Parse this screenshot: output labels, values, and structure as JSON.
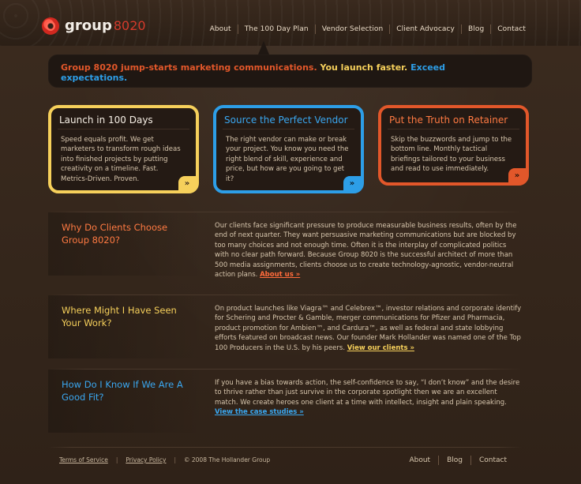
{
  "brand": {
    "name": "group",
    "number": "8020"
  },
  "nav": {
    "items": [
      {
        "label": "About"
      },
      {
        "label": "The 100 Day Plan"
      },
      {
        "label": "Vendor Selection"
      },
      {
        "label": "Client Advocacy"
      },
      {
        "label": "Blog"
      },
      {
        "label": "Contact"
      }
    ]
  },
  "hero": {
    "part1": "Group 8020 jump-starts marketing communications.",
    "part2": "You launch faster.",
    "part3": "Exceed expectations."
  },
  "cards": [
    {
      "title": "Launch in 100 Days",
      "body": "Speed equals profit. We get marketers to transform rough ideas into finished projects by putting creativity on a timeline. Fast. Metrics-Driven. Proven.",
      "more": "»",
      "accent": "#f6d05b"
    },
    {
      "title": "Source the Perfect Vendor",
      "body": "The right vendor can make or break your project. You know you need the right blend of skill, experience and price, but how are you going to get it?",
      "more": "»",
      "accent": "#2d9ee7"
    },
    {
      "title": "Put the Truth on Retainer",
      "body": "Skip the buzzwords and jump to the bottom line. Monthly tactical briefings tailored to your business and read to use immediately.",
      "more": "»",
      "accent": "#e2572a"
    }
  ],
  "sections": [
    {
      "title": "Why Do Clients Choose Group 8020?",
      "title_color": "#ff7a42",
      "body": "Our clients face significant pressure to produce measurable business results, often by the end of next quarter. They want persuasive marketing communications but are blocked by too many choices and not enough time. Often it is the interplay of complicated politics with no clear path forward. Because Group 8020 is the successful architect of more than 500 media assignments, clients choose us to create technology-agnostic, vendor-neutral action plans.",
      "link": "About us »"
    },
    {
      "title": "Where Might I Have Seen Your Work?",
      "title_color": "#f6d05b",
      "body": "On product launches like Viagra™ and Celebrex™, investor relations and corporate identify for Schering and Procter & Gamble, merger communications for Pfizer and Pharmacia, product promotion for Ambien™, and Cardura™, as well as federal and state lobbying efforts featured on broadcast news. Our founder Mark Hollander was named one of the Top 100 Producers in the U.S. by his peers.",
      "link": "View our clients »"
    },
    {
      "title": "How Do I Know If We Are A Good Fit?",
      "title_color": "#3aa7f0",
      "body": "If you have a bias towards action, the self-confidence to say, “I don’t know” and the desire to thrive rather than just survive in the corporate spotlight then we are an excellent match. We create heroes one client at a time with intellect, insight and plain speaking.",
      "link": "View the case studies »"
    }
  ],
  "footer": {
    "terms": "Terms of Service",
    "privacy": "Privacy Policy",
    "copyright": "© 2008 The Hollander Group",
    "right_links": [
      {
        "label": "About"
      },
      {
        "label": "Blog"
      },
      {
        "label": "Contact"
      }
    ]
  }
}
